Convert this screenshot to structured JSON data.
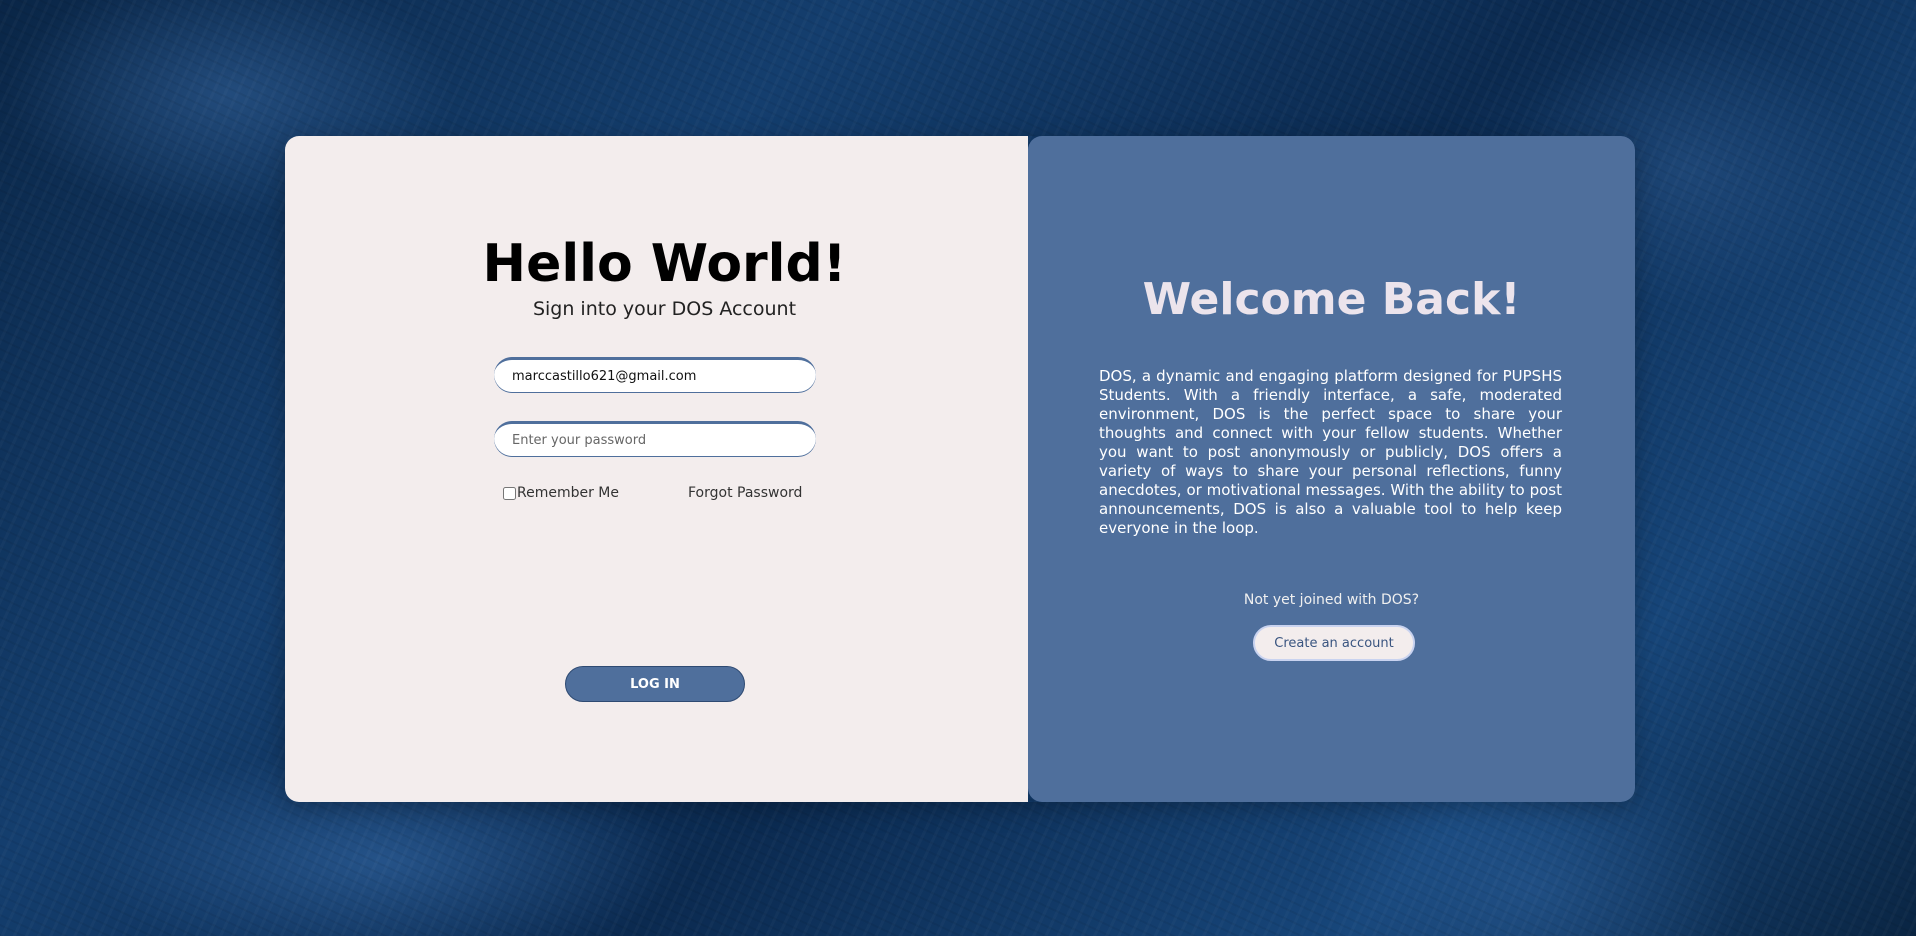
{
  "login": {
    "heading": "Hello World!",
    "subtitle": "Sign into your DOS Account",
    "email_value": "marccastillo621@gmail.com",
    "password_placeholder": "Enter your password",
    "remember_label": "Remember Me",
    "remember_checked": false,
    "forgot_label": "Forgot Password",
    "login_button": "LOG IN"
  },
  "welcome": {
    "heading": "Welcome Back!",
    "description": "DOS, a dynamic and engaging platform designed for PUPSHS Students. With a friendly interface, a safe, moderated environment, DOS is the perfect space to share your thoughts and connect with your fellow students. Whether you want to post anonymously or publicly, DOS offers a variety of ways to share your personal reflections, funny anecdotes, or motivational messages. With the ability to post announcements, DOS is also a valuable tool to help keep everyone in the loop.",
    "not_joined": "Not yet joined with DOS?",
    "create_button": "Create an account"
  },
  "colors": {
    "accent": "#4f6f9c",
    "panel_light": "#f3eded",
    "background": "#0d2e55"
  }
}
